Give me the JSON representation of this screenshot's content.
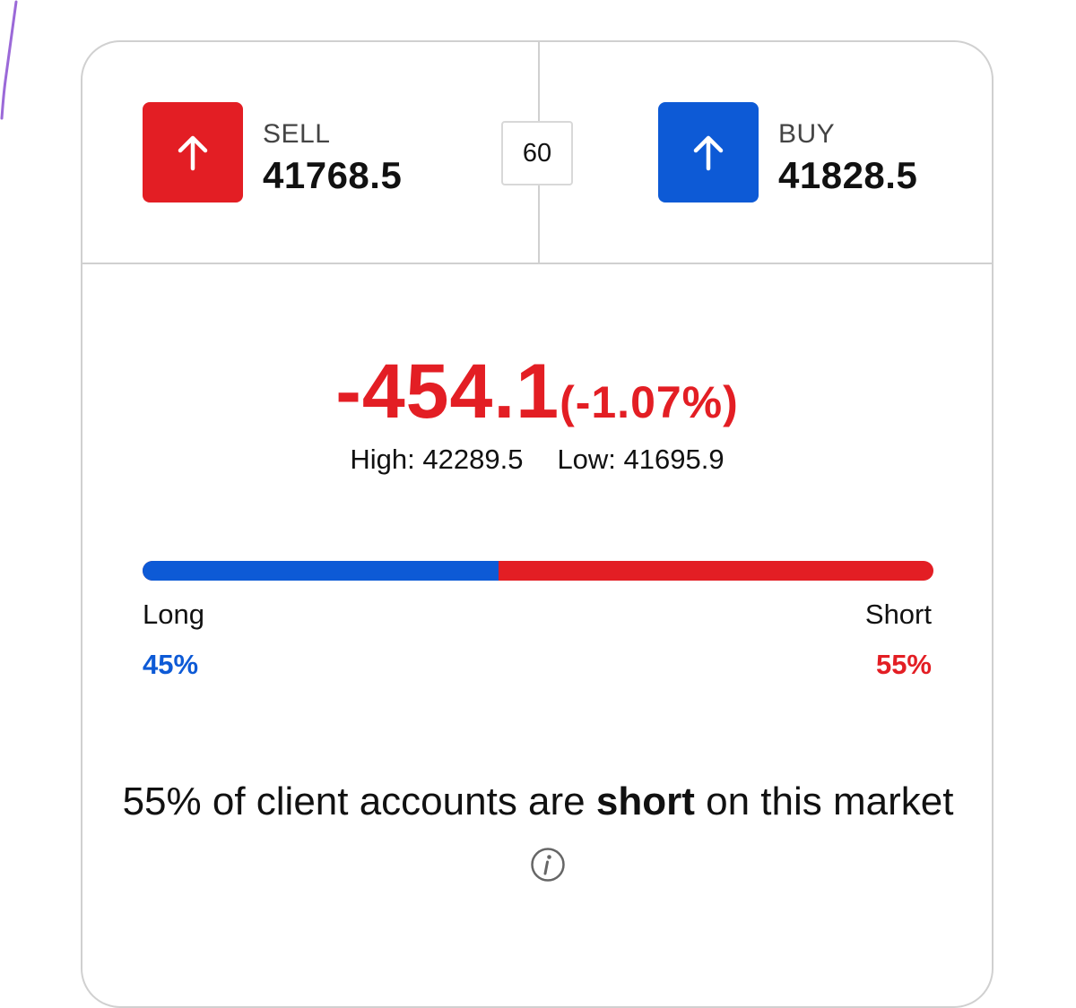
{
  "sell": {
    "label": "SELL",
    "price": "41768.5",
    "icon": "arrow-up-icon",
    "color": "#e31e24"
  },
  "buy": {
    "label": "BUY",
    "price": "41828.5",
    "icon": "arrow-up-icon",
    "color": "#0d5ad6"
  },
  "spread": "60",
  "change": {
    "absolute": "-454.1",
    "percent": "(-1.07%)",
    "color": "#e31e24"
  },
  "high": "High: 42289.5",
  "low": "Low: 41695.9",
  "sentiment": {
    "long_label": "Long",
    "long_percent": "45%",
    "long_fraction": 0.45,
    "short_label": "Short",
    "short_percent": "55%",
    "short_fraction": 0.55,
    "long_color": "#0d5ad6",
    "short_color": "#e31e24"
  },
  "summary": {
    "prefix": "55% of client accounts are ",
    "emphasis": "short",
    "suffix": " on this market",
    "info_icon": "info-icon"
  }
}
